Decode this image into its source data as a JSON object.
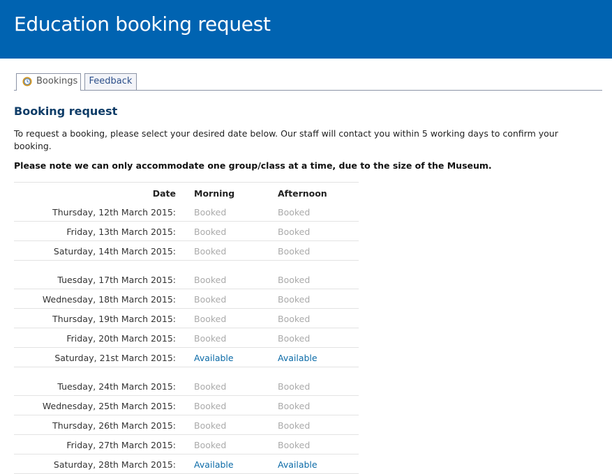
{
  "header": {
    "title": "Education booking request"
  },
  "tabs": [
    {
      "label": "Bookings",
      "icon": "clock-icon",
      "active": true
    },
    {
      "label": "Feedback",
      "active": false
    }
  ],
  "section_title": "Booking request",
  "intro": "To request a booking, please select your desired date below. Our staff will contact you within 5 working days to confirm your booking.",
  "note": "Please note we can only accommodate one group/class at a time, due to the size of the Museum.",
  "table": {
    "headers": {
      "date": "Date",
      "morning": "Morning",
      "afternoon": "Afternoon"
    },
    "rows": [
      {
        "date": "Thursday, 12th March 2015:",
        "morning": "Booked",
        "afternoon": "Booked"
      },
      {
        "date": "Friday, 13th March 2015:",
        "morning": "Booked",
        "afternoon": "Booked"
      },
      {
        "date": "Saturday, 14th March 2015:",
        "morning": "Booked",
        "afternoon": "Booked"
      },
      {
        "date": "Tuesday, 17th March 2015:",
        "morning": "Booked",
        "afternoon": "Booked"
      },
      {
        "date": "Wednesday, 18th March 2015:",
        "morning": "Booked",
        "afternoon": "Booked"
      },
      {
        "date": "Thursday, 19th March 2015:",
        "morning": "Booked",
        "afternoon": "Booked"
      },
      {
        "date": "Friday, 20th March 2015:",
        "morning": "Booked",
        "afternoon": "Booked"
      },
      {
        "date": "Saturday, 21st March 2015:",
        "morning": "Available",
        "afternoon": "Available"
      },
      {
        "date": "Tuesday, 24th March 2015:",
        "morning": "Booked",
        "afternoon": "Booked"
      },
      {
        "date": "Wednesday, 25th March 2015:",
        "morning": "Booked",
        "afternoon": "Booked"
      },
      {
        "date": "Thursday, 26th March 2015:",
        "morning": "Booked",
        "afternoon": "Booked"
      },
      {
        "date": "Friday, 27th March 2015:",
        "morning": "Booked",
        "afternoon": "Booked"
      },
      {
        "date": "Saturday, 28th March 2015:",
        "morning": "Available",
        "afternoon": "Available"
      }
    ]
  },
  "colors": {
    "header_bg": "#0063b1",
    "available": "#0a6aa7",
    "booked": "#aaaaaa",
    "section_title": "#0f3d68"
  }
}
